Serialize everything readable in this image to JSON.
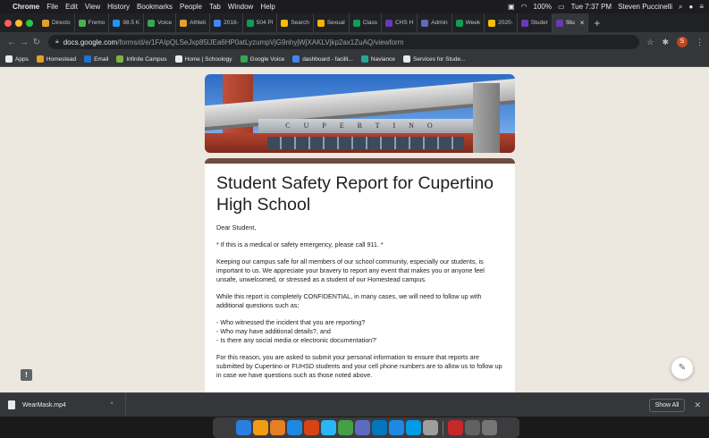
{
  "menubar": {
    "apple": "",
    "app": "Chrome",
    "items": [
      "File",
      "Edit",
      "View",
      "History",
      "Bookmarks",
      "People",
      "Tab",
      "Window",
      "Help"
    ],
    "battery": "100%",
    "clock": "Tue 7:37 PM",
    "user": "Steven Puccinelli"
  },
  "tabs": [
    {
      "label": "Directo",
      "color": "#e0a22b"
    },
    {
      "label": "Fremo",
      "color": "#4caf50"
    },
    {
      "label": "98.5 K",
      "color": "#2196f3"
    },
    {
      "label": "Voice",
      "color": "#34a853"
    },
    {
      "label": "Athleti",
      "color": "#e0a22b"
    },
    {
      "label": "2018-",
      "color": "#4285f4"
    },
    {
      "label": "504 Pl",
      "color": "#0f9d58"
    },
    {
      "label": "Search",
      "color": "#fbbc04"
    },
    {
      "label": "Sexual",
      "color": "#f4b400"
    },
    {
      "label": "Class",
      "color": "#0f9d58"
    },
    {
      "label": "CHS H",
      "color": "#673ab7"
    },
    {
      "label": "Admin",
      "color": "#5c6bc0"
    },
    {
      "label": "Week",
      "color": "#0f9d58"
    },
    {
      "label": "2020-",
      "color": "#fbbc04"
    },
    {
      "label": "Studer",
      "color": "#673ab7"
    },
    {
      "label": "Stu",
      "color": "#673ab7",
      "active": true
    }
  ],
  "address": {
    "host": "docs.google.com",
    "path": "/forms/d/e/1FAIpQLSeJxp85lJEa6HP0atLyzumpVjG9nhyjWjXAKLVjkp2ax1ZuAQ/viewform",
    "profile_initial": "S"
  },
  "bookmarks": [
    {
      "label": "Apps",
      "color": "#e8eaed"
    },
    {
      "label": "Homestead",
      "color": "#e0a22b"
    },
    {
      "label": "Email",
      "color": "#1976d2"
    },
    {
      "label": "Infinite Campus",
      "color": "#7cb342"
    },
    {
      "label": "Home | Schoology",
      "color": "#e8eaed"
    },
    {
      "label": "Google Voice",
      "color": "#34a853"
    },
    {
      "label": "dashboard - facilit...",
      "color": "#4285f4"
    },
    {
      "label": "Naviance",
      "color": "#26a69a"
    },
    {
      "label": "Services for Stude...",
      "color": "#e8eaed"
    }
  ],
  "form": {
    "banner_text": "CUPERTINO",
    "title": "Student Safety Report for Cupertino High School",
    "greeting": "Dear Student,",
    "emergency": "* If this is a medical or safety emergency, please call 911. *",
    "intro": "Keeping our campus safe for all members of our school community, especially our students, is important to us. We appreciate your bravery to report any event that makes you or anyone feel unsafe, unwelcomed, or stressed as a student of our Homestead campus.",
    "confidential": "While this report is completely CONFIDENTIAL, in many cases, we will need to follow up with additional questions such as;",
    "questions": [
      "- Who witnessed the incident that you are reporting?",
      "- Who may have additional details?, and",
      "- Is there any social media or electronic documentation?'"
    ],
    "closing": "For this reason, you are asked to submit your personal information to ensure that reports are submitted by Cupertino or FUHSD students and your cell phone numbers are to allow us to follow up in case we have questions such as those noted above."
  },
  "download": {
    "filename": "WearMask.mp4",
    "show_all": "Show All"
  },
  "dock_colors": [
    "#2a7de1",
    "#f39c12",
    "#e67e22",
    "#1e88e5",
    "#d84315",
    "#29b6f6",
    "#43a047",
    "#5c6bc0",
    "#0277bd",
    "#1e88e5",
    "#039be5",
    "#9e9e9e",
    "#c62828",
    "#616161",
    "#757575"
  ]
}
